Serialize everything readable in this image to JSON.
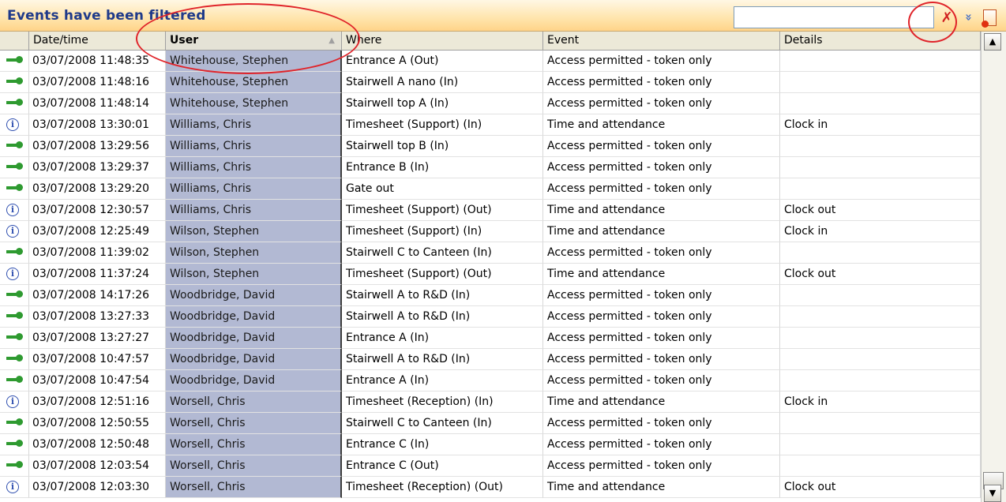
{
  "title": "Events have been filtered",
  "search": {
    "value": "",
    "placeholder": ""
  },
  "toolbar": {
    "clear_icon": "clear-filter-icon",
    "expand_icon": "expand-down-icon",
    "export_icon": "export-report-icon",
    "clear_glyph": "✗",
    "expand_glyph": "»"
  },
  "columns": [
    "",
    "Date/time",
    "User",
    "Where",
    "Event",
    "Details"
  ],
  "sort_arrow": "▲",
  "colors": {
    "accent": "#1f3a8a",
    "user_column": "#b2b9d3",
    "annotation": "#e0242a",
    "key_icon": "#2e9a30",
    "info_icon": "#3050b0"
  },
  "rows": [
    {
      "icon": "key",
      "datetime": "03/07/2008 11:48:35",
      "user": "Whitehouse, Stephen",
      "where": "Entrance A (Out)",
      "event": "Access permitted - token only",
      "details": ""
    },
    {
      "icon": "key",
      "datetime": "03/07/2008 11:48:16",
      "user": "Whitehouse, Stephen",
      "where": "Stairwell A nano (In)",
      "event": "Access permitted - token only",
      "details": ""
    },
    {
      "icon": "key",
      "datetime": "03/07/2008 11:48:14",
      "user": "Whitehouse, Stephen",
      "where": "Stairwell top A (In)",
      "event": "Access permitted - token only",
      "details": ""
    },
    {
      "icon": "info",
      "datetime": "03/07/2008 13:30:01",
      "user": "Williams,  Chris",
      "where": "Timesheet (Support) (In)",
      "event": "Time and attendance",
      "details": "Clock in"
    },
    {
      "icon": "key",
      "datetime": "03/07/2008 13:29:56",
      "user": "Williams,  Chris",
      "where": "Stairwell top B (In)",
      "event": "Access permitted - token only",
      "details": ""
    },
    {
      "icon": "key",
      "datetime": "03/07/2008 13:29:37",
      "user": "Williams,  Chris",
      "where": "Entrance B (In)",
      "event": "Access permitted - token only",
      "details": ""
    },
    {
      "icon": "key",
      "datetime": "03/07/2008 13:29:20",
      "user": "Williams,  Chris",
      "where": "Gate out",
      "event": "Access permitted - token only",
      "details": ""
    },
    {
      "icon": "info",
      "datetime": "03/07/2008 12:30:57",
      "user": "Williams,  Chris",
      "where": "Timesheet (Support) (Out)",
      "event": "Time and attendance",
      "details": "Clock out"
    },
    {
      "icon": "info",
      "datetime": "03/07/2008 12:25:49",
      "user": "Wilson, Stephen",
      "where": "Timesheet (Support) (In)",
      "event": "Time and attendance",
      "details": "Clock in"
    },
    {
      "icon": "key",
      "datetime": "03/07/2008 11:39:02",
      "user": "Wilson, Stephen",
      "where": "Stairwell C to Canteen (In)",
      "event": "Access permitted - token only",
      "details": ""
    },
    {
      "icon": "info",
      "datetime": "03/07/2008 11:37:24",
      "user": "Wilson, Stephen",
      "where": "Timesheet (Support) (Out)",
      "event": "Time and attendance",
      "details": "Clock out"
    },
    {
      "icon": "key",
      "datetime": "03/07/2008 14:17:26",
      "user": "Woodbridge, David",
      "where": "Stairwell A to R&D (In)",
      "event": "Access permitted - token only",
      "details": ""
    },
    {
      "icon": "key",
      "datetime": "03/07/2008 13:27:33",
      "user": "Woodbridge, David",
      "where": "Stairwell A to R&D (In)",
      "event": "Access permitted - token only",
      "details": ""
    },
    {
      "icon": "key",
      "datetime": "03/07/2008 13:27:27",
      "user": "Woodbridge, David",
      "where": "Entrance A (In)",
      "event": "Access permitted - token only",
      "details": ""
    },
    {
      "icon": "key",
      "datetime": "03/07/2008 10:47:57",
      "user": "Woodbridge, David",
      "where": "Stairwell A to R&D (In)",
      "event": "Access permitted - token only",
      "details": ""
    },
    {
      "icon": "key",
      "datetime": "03/07/2008 10:47:54",
      "user": "Woodbridge, David",
      "where": "Entrance A (In)",
      "event": "Access permitted - token only",
      "details": ""
    },
    {
      "icon": "info",
      "datetime": "03/07/2008 12:51:16",
      "user": "Worsell,  Chris",
      "where": "Timesheet (Reception) (In)",
      "event": "Time and attendance",
      "details": "Clock in"
    },
    {
      "icon": "key",
      "datetime": "03/07/2008 12:50:55",
      "user": "Worsell,  Chris",
      "where": "Stairwell C to Canteen (In)",
      "event": "Access permitted - token only",
      "details": ""
    },
    {
      "icon": "key",
      "datetime": "03/07/2008 12:50:48",
      "user": "Worsell,  Chris",
      "where": "Entrance C (In)",
      "event": "Access permitted - token only",
      "details": ""
    },
    {
      "icon": "key",
      "datetime": "03/07/2008 12:03:54",
      "user": "Worsell,  Chris",
      "where": "Entrance C (Out)",
      "event": "Access permitted - token only",
      "details": ""
    },
    {
      "icon": "info",
      "datetime": "03/07/2008 12:03:30",
      "user": "Worsell,  Chris",
      "where": "Timesheet (Reception) (Out)",
      "event": "Time and attendance",
      "details": "Clock out"
    }
  ],
  "info_glyph": "i"
}
